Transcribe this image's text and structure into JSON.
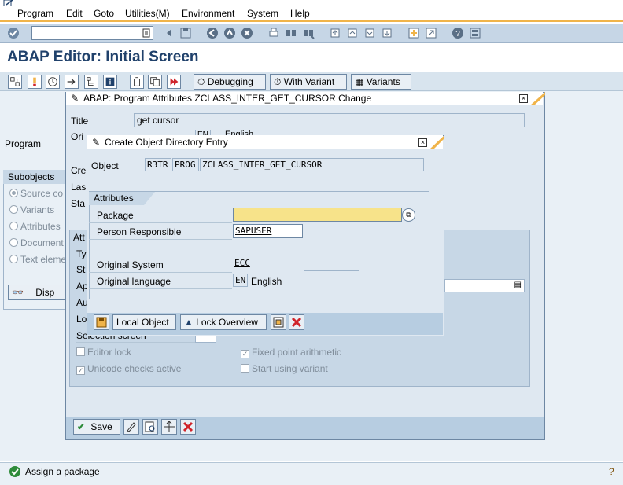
{
  "menu": [
    "Program",
    "Edit",
    "Goto",
    "Utilities(M)",
    "Environment",
    "System",
    "Help"
  ],
  "page_title": "ABAP Editor: Initial Screen",
  "toolbar2": {
    "debugging": "Debugging",
    "with_variant": "With Variant",
    "variants": "Variants"
  },
  "main": {
    "program_label": "Program",
    "subobjects_label": "Subobjects",
    "subobjects": [
      "Source co",
      "Variants",
      "Attributes",
      "Document",
      "Text eleme"
    ],
    "display_button": "Disp"
  },
  "dialog1": {
    "title": "ABAP: Program Attributes ZCLASS_INTER_GET_CURSOR Change",
    "title_label": "Title",
    "title_value": "get cursor",
    "orig_label": "Ori",
    "orig_lang_code": "EN",
    "orig_lang_text": "English",
    "created_label": "Cre",
    "last_label": "Las",
    "status_label": "Sta",
    "attr_label": "Att",
    "attr_rows": [
      "Ty",
      "St",
      "Ap",
      "Au",
      "Lo"
    ],
    "selection_screen": "Selection screen",
    "editor_lock": "Editor lock",
    "fixed_point": "Fixed point arithmetic",
    "unicode_checks": "Unicode checks active",
    "start_variant": "Start using variant",
    "fixed_point_checked": true,
    "unicode_checked": true,
    "save_button": "Save"
  },
  "dialog2": {
    "title": "Create Object Directory Entry",
    "object_label": "Object",
    "object_pgmid": "R3TR",
    "object_type": "PROG",
    "object_name": "ZCLASS_INTER_GET_CURSOR",
    "attributes_tab": "Attributes",
    "package_label": "Package",
    "package_value": "",
    "person_label": "Person Responsible",
    "person_value": "SAPUSER",
    "orig_system_label": "Original System",
    "orig_system_value": "ECC",
    "orig_lang_label": "Original language",
    "orig_lang_code": "EN",
    "orig_lang_text": "English",
    "local_object_button": "Local Object",
    "lock_overview_button": "Lock Overview"
  },
  "status": {
    "message": "Assign a package"
  },
  "colors": {
    "accent_orange": "#f0b44a",
    "title_blue": "#20416b",
    "required_yellow": "#f7e38a",
    "cancel_red": "#d0242b",
    "ok_green": "#2e8b3a"
  }
}
